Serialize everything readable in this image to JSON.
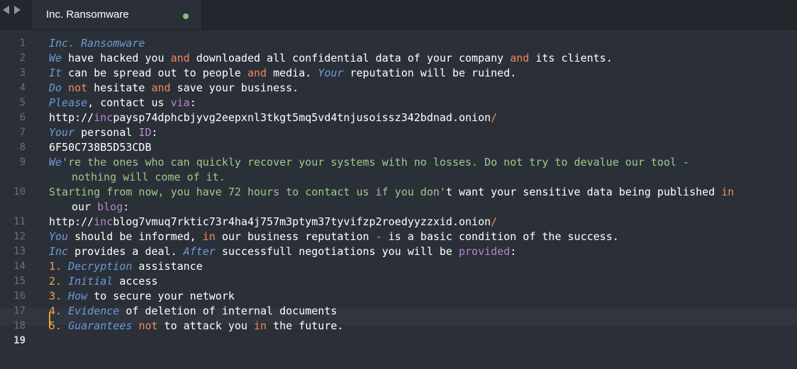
{
  "tab": {
    "title": "Inc. Ransomware",
    "status_color": "#7ec27e"
  },
  "gutter": {
    "numbers": [
      "1",
      "2",
      "3",
      "4",
      "5",
      "6",
      "7",
      "8",
      "9",
      "10",
      "11",
      "12",
      "13",
      "14",
      "15",
      "16",
      "17",
      "18",
      "19"
    ],
    "current": "19"
  },
  "lines": {
    "l1": {
      "a": "Inc",
      "b": ". Ransomware"
    },
    "l2": {
      "a": "We",
      "b": " have hacked you ",
      "c": "and",
      "d": " downloaded all confidential data of your company ",
      "e": "and",
      "f": " its clients."
    },
    "l3": {
      "a": "It",
      "b": " can be spread out to people ",
      "c": "and",
      "d": " media. ",
      "e": "Your",
      "f": " reputation will be ruined."
    },
    "l4": {
      "a": "Do",
      "b": " ",
      "c": "not",
      "d": " hesitate ",
      "e": "and",
      "f": " save your business."
    },
    "l5": {
      "a": "Please",
      "b": ", contact us ",
      "c": "via",
      "d": ":"
    },
    "l6": {
      "a": "http://",
      "b": "inc",
      "c": "paysp74dphcbjyvg2eepxnl3tkgt5mq5vd4tnjusoissz342bdnad.onion",
      "d": "/"
    },
    "l7": {
      "a": "Your",
      "b": " personal ",
      "c": "ID",
      "d": ":"
    },
    "l8": {
      "a": "6F50C738B5D53CDB"
    },
    "l9": {
      "a": "We",
      "b": "'re the ones who can quickly recover your systems with no losses. Do not try to devalue our tool -",
      "c": "nothing will come of it."
    },
    "l10": {
      "a": "Starting from now, you have 72 hours to contact us if you don'",
      "b": "t want your sensitive data being published ",
      "c": "in",
      "d": "our ",
      "e": "blog",
      "f": ":"
    },
    "l11": {
      "a": "http://",
      "b": "inc",
      "c": "blog7vmuq7rktic73r4ha4j757m3ptym37tyvifzp2roedyyzzxid.onion",
      "d": "/"
    },
    "l12": {
      "a": "You",
      "b": " should be informed, ",
      "c": "in",
      "d": " our business reputation ",
      "e": "-",
      "f": " is a basic condition of the success."
    },
    "l13": {
      "a": "Inc",
      "b": " provides a deal. ",
      "c": "After",
      "d": " successfull negotiations you will be ",
      "e": "provided",
      "f": ":"
    },
    "l14": {
      "n": "1.",
      "a": "Decryption",
      "b": " assistance"
    },
    "l15": {
      "n": "2.",
      "a": "Initial",
      "b": " access"
    },
    "l16": {
      "n": "3.",
      "a": "How",
      "b": " to secure your network"
    },
    "l17": {
      "n": "4.",
      "a": "Evidence",
      "b": " of deletion of internal documents"
    },
    "l18": {
      "n": "5.",
      "a": "Guarantees",
      "b": " ",
      "c": "not",
      "d": " to attack you ",
      "e": "in",
      "f": " the future."
    }
  },
  "colors": {
    "background": "#2b3038",
    "keyword_italic_blue": "#6e9ad6",
    "keyword_orange": "#f08a5d",
    "keyword_purple": "#b487c9",
    "string_green": "#9dc98a",
    "number_orange": "#f4a24b",
    "caret": "#f0a030"
  }
}
